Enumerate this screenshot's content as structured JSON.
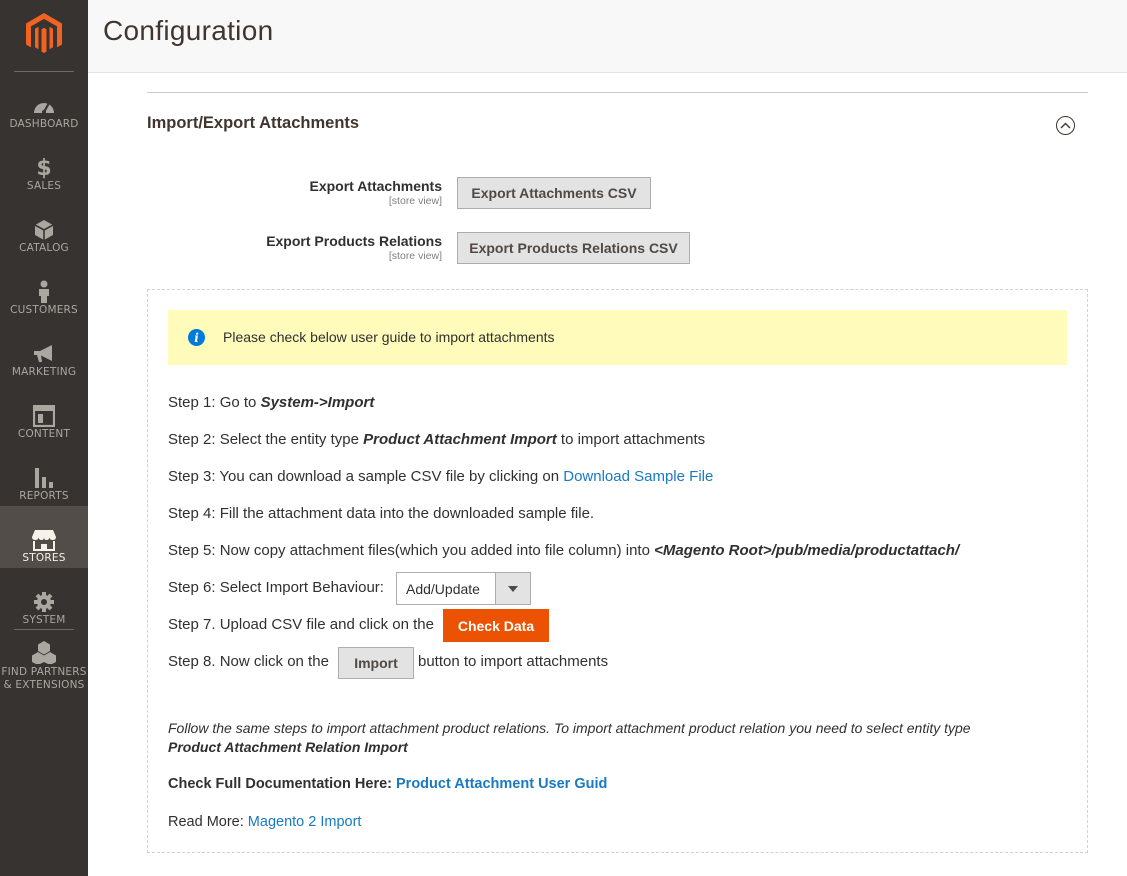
{
  "sidebar": {
    "logo": "magento-logo",
    "items": [
      {
        "label": "DASHBOARD",
        "icon": "dashboard-icon"
      },
      {
        "label": "SALES",
        "icon": "dollar-icon"
      },
      {
        "label": "CATALOG",
        "icon": "cube-icon"
      },
      {
        "label": "CUSTOMERS",
        "icon": "person-icon"
      },
      {
        "label": "MARKETING",
        "icon": "megaphone-icon"
      },
      {
        "label": "CONTENT",
        "icon": "layout-icon"
      },
      {
        "label": "REPORTS",
        "icon": "bar-chart-icon"
      },
      {
        "label": "STORES",
        "icon": "store-icon",
        "active": true
      },
      {
        "label": "SYSTEM",
        "icon": "gear-icon"
      },
      {
        "label_line1": "FIND PARTNERS",
        "label_line2": "& EXTENSIONS",
        "icon": "cubes-icon"
      }
    ]
  },
  "header": {
    "title": "Configuration"
  },
  "section": {
    "title": "Import/Export Attachments",
    "rows": [
      {
        "label": "Export Attachments",
        "scope": "[store view]",
        "button": "Export Attachments CSV"
      },
      {
        "label": "Export Products Relations",
        "scope": "[store view]",
        "button": "Export Products Relations CSV"
      }
    ]
  },
  "guide": {
    "notice": "Please check below user guide to import attachments",
    "step1_pre": "Step 1: Go to ",
    "step1_em": "System->Import",
    "step2_pre": "Step 2: Select the entity type ",
    "step2_em": "Product Attachment Import",
    "step2_post": " to import attachments",
    "step3_pre": "Step 3: You can download a sample CSV file by clicking on ",
    "step3_link": "Download Sample File",
    "step4": "Step 4: Fill the attachment data into the downloaded sample file.",
    "step5_pre": "Step 5: Now copy attachment files(which you added into file column) into ",
    "step5_em": "<Magento Root>/pub/media/productattach/",
    "step6_pre": "Step 6: Select Import Behaviour:",
    "step6_select": "Add/Update",
    "step7_pre": "Step 7. Upload CSV file and click on the",
    "step7_button": "Check Data",
    "step8_pre": "Step 8. Now click on the",
    "step8_button": "Import",
    "step8_post": "button to import attachments",
    "footnote": "Follow the same steps to import attachment product relations. To import attachment product relation you need to select entity type",
    "footnote_em": "Product Attachment Relation Import",
    "doc_label": "Check Full Documentation Here: ",
    "doc_link": "Product Attachment User Guid",
    "read_more_label": "Read More: ",
    "read_more_link": "Magento 2 Import"
  },
  "colors": {
    "sidebar": "#373330",
    "active": "#524d49",
    "accent": "#eb5202",
    "link": "#1979c3",
    "notice": "#fffbbb"
  }
}
